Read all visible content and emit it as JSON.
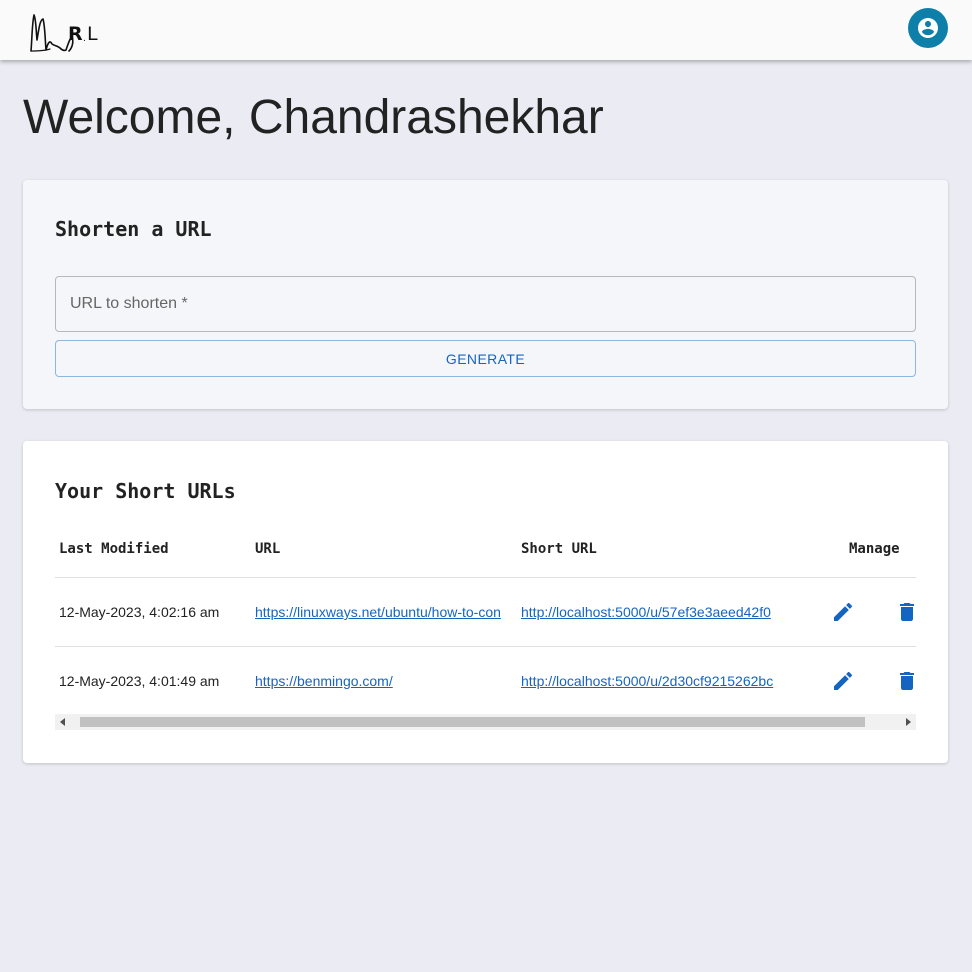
{
  "app": {
    "logo_alt": "Url logo",
    "account_icon": "account-circle-icon",
    "accent": "#0e7fa8",
    "link_color": "#1565c0"
  },
  "welcome": "Welcome, Chandrashekhar",
  "shorten": {
    "title": "Shorten a URL",
    "placeholder": "URL to shorten *",
    "value": "",
    "button": "GENERATE"
  },
  "urls": {
    "title": "Your Short URLs",
    "headers": [
      "Last Modified",
      "URL",
      "Short URL",
      "Manage"
    ],
    "rows": [
      {
        "modified": "12-May-2023, 4:02:16 am",
        "url": "https://linuxways.net/ubuntu/how-to-con",
        "short_url": "http://localhost:5000/u/57ef3e3aeed42f0"
      },
      {
        "modified": "12-May-2023, 4:01:49 am",
        "url": "https://benmingo.com/",
        "short_url": "http://localhost:5000/u/2d30cf9215262bc"
      }
    ],
    "scrollbar": {
      "thumb_fraction": 0.94,
      "position_fraction": 0
    }
  }
}
